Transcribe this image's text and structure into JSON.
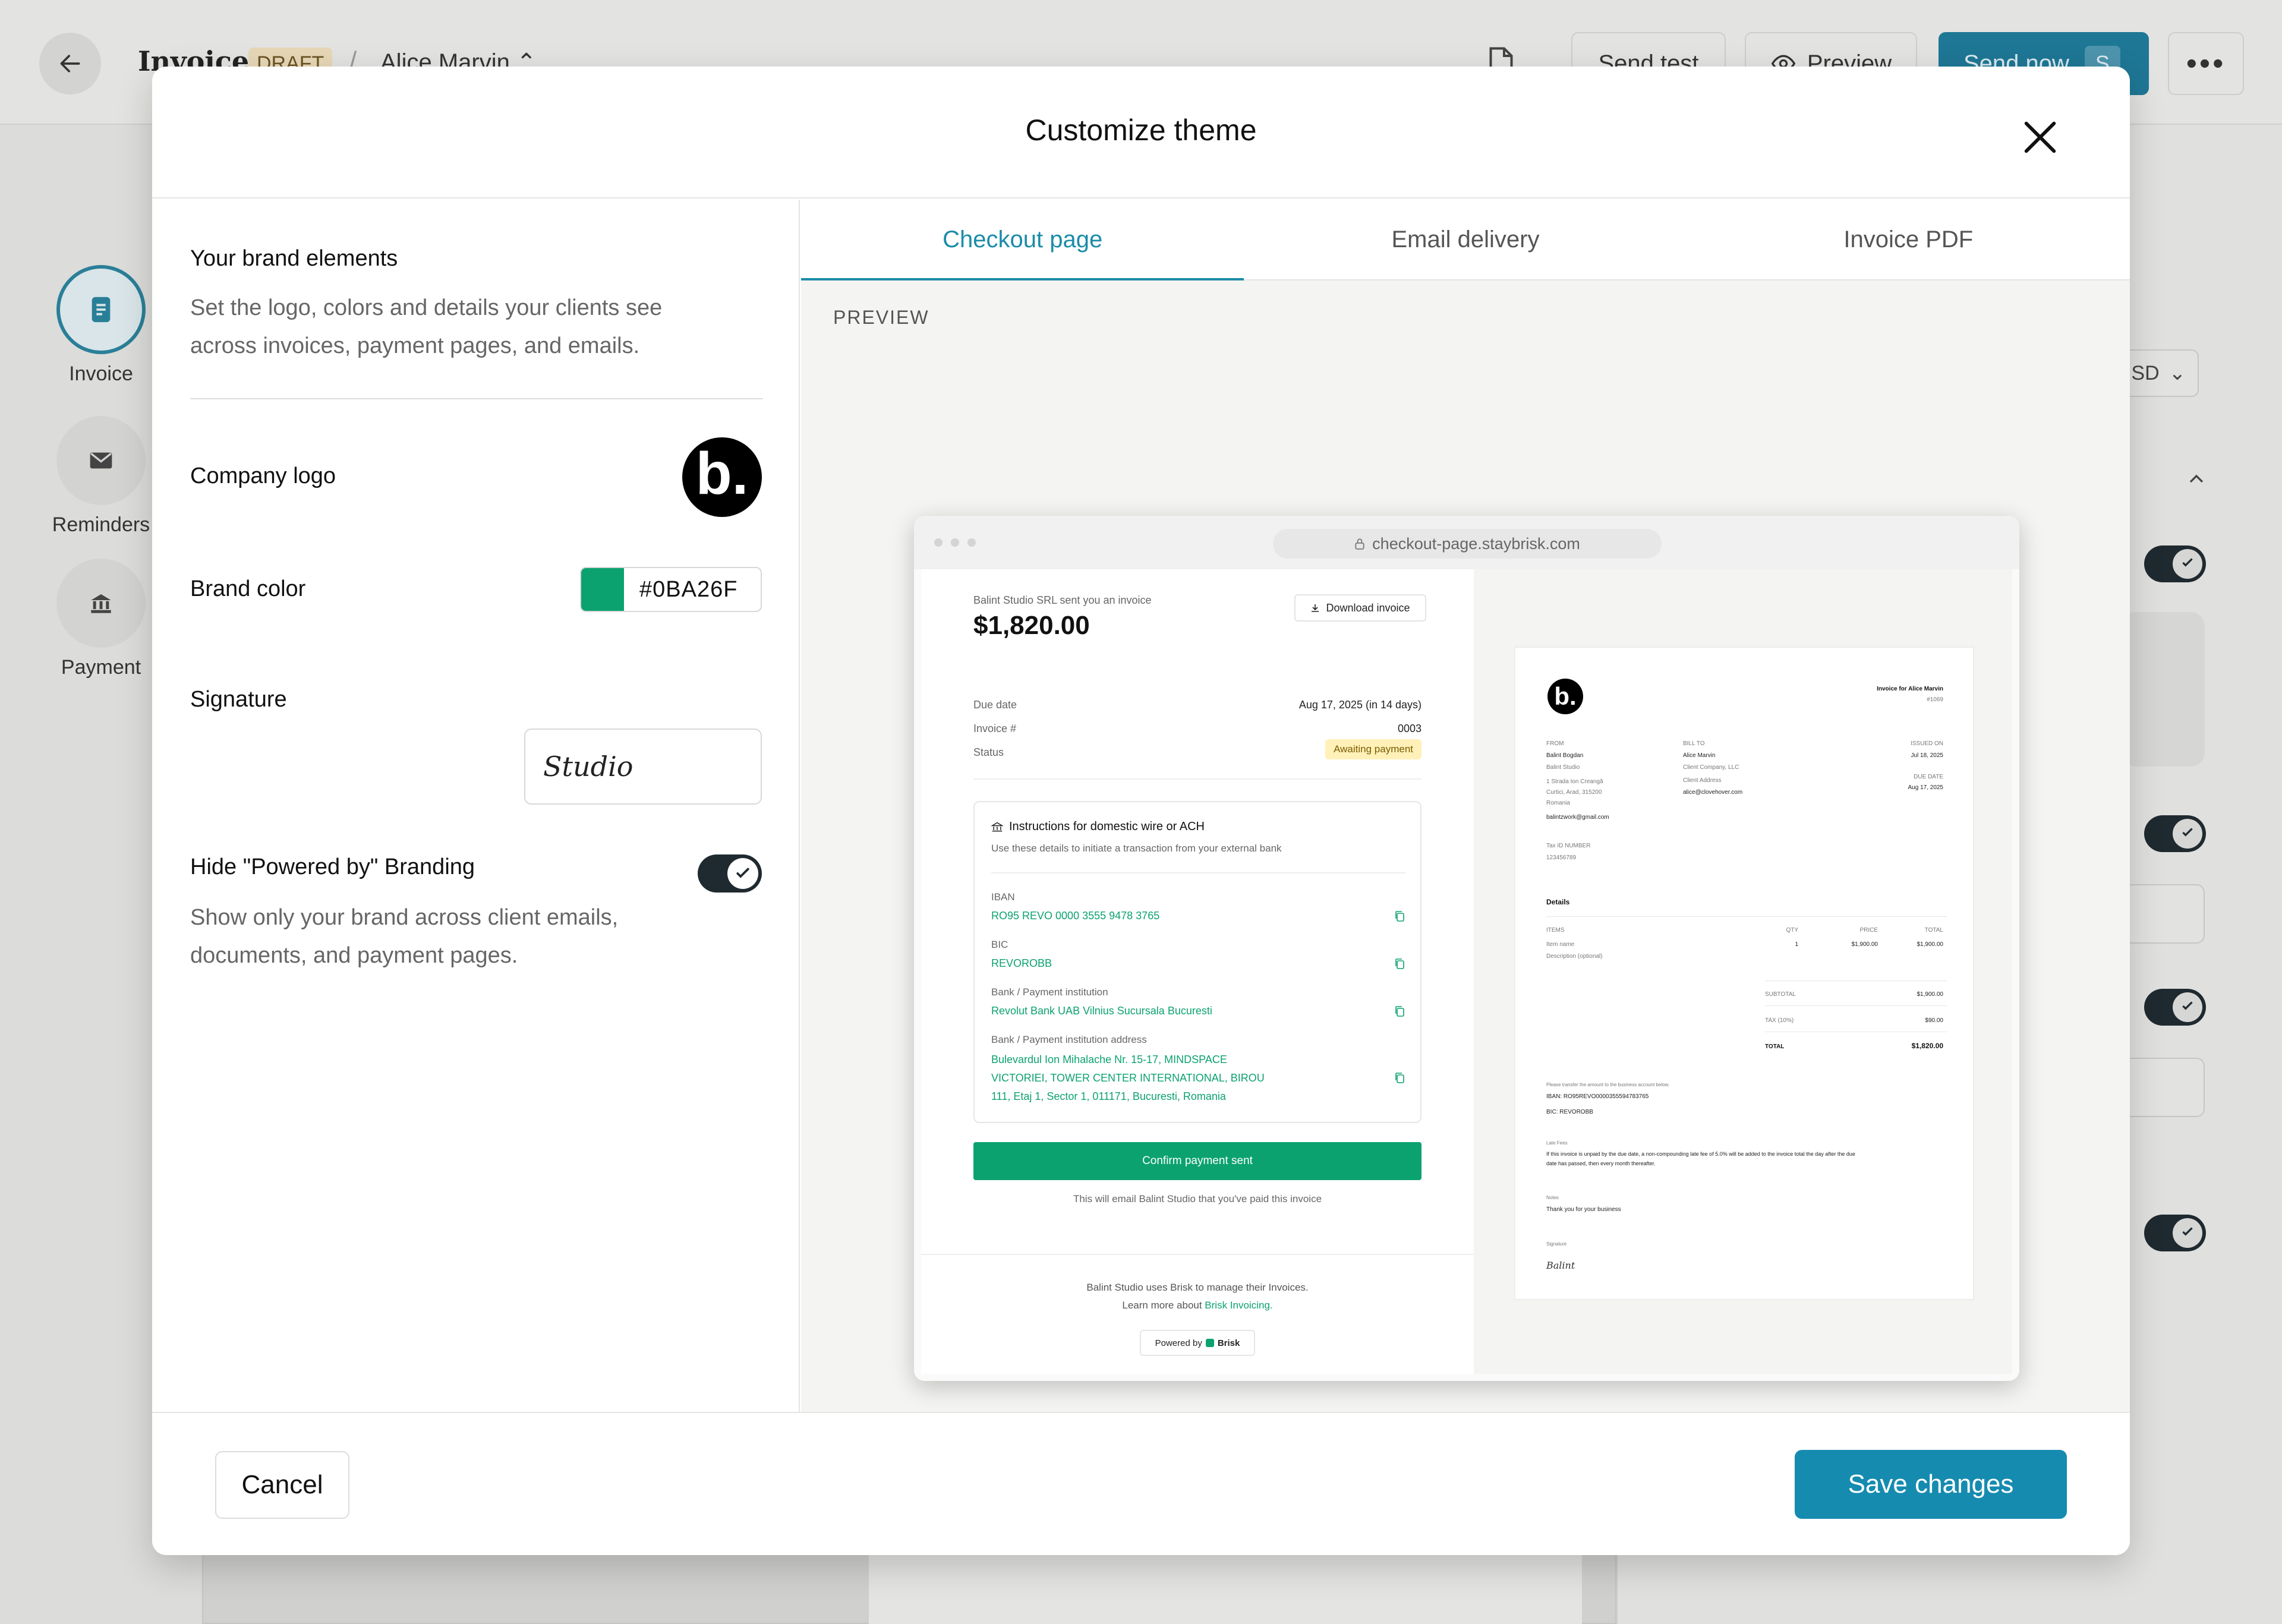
{
  "background": {
    "title": "Invoice",
    "badge": "DRAFT",
    "separator": "/",
    "client": "Alice Marvin",
    "send_test": "Send test",
    "preview": "Preview",
    "send_now": "Send now",
    "send_now_key": "S",
    "more": "•••",
    "currency": "USD",
    "rail": [
      {
        "label": "Invoice",
        "icon": "document-icon"
      },
      {
        "label": "Reminders",
        "icon": "mail-icon"
      },
      {
        "label": "Payment",
        "icon": "bank-icon"
      }
    ]
  },
  "modal": {
    "title": "Customize theme",
    "brand": {
      "title": "Your brand elements",
      "description": "Set the logo, colors and details your clients see across invoices, payment pages, and emails."
    },
    "company_logo_label": "Company logo",
    "logo_letter": "b.",
    "brand_color_label": "Brand color",
    "brand_color": "#0BA26F",
    "brand_color_text": "#0BA26F",
    "signature_label": "Signature",
    "signature_text": "Studio",
    "hide_branding_label": "Hide \"Powered by\" Branding",
    "hide_branding_on": true,
    "hide_branding_desc": "Show only your brand across client emails, documents, and payment pages.",
    "tabs": [
      "Checkout page",
      "Email delivery",
      "Invoice PDF"
    ],
    "active_tab": 0,
    "preview_label": "PREVIEW",
    "cancel": "Cancel",
    "save": "Save changes",
    "accent": "#168BB0"
  },
  "checkout": {
    "url": "checkout-page.staybrisk.com",
    "sender_line": "Balint Studio SRL sent you an invoice",
    "amount": "$1,820.00",
    "download": "Download invoice",
    "due_label": "Due date",
    "due_value": "Aug 17, 2025 (in 14 days)",
    "invoice_label": "Invoice #",
    "invoice_value": "0003",
    "status_label": "Status",
    "status_value": "Awaiting payment",
    "wire_title": "Instructions for domestic wire or ACH",
    "wire_sub": "Use these details to initiate a transaction from your external bank",
    "iban_label": "IBAN",
    "iban": "RO95 REVO 0000 3555 9478 3765",
    "bic_label": "BIC",
    "bic": "REVOROBB",
    "bank_label": "Bank / Payment institution",
    "bank": "Revolut Bank UAB Vilnius Sucursala Bucuresti",
    "address_label": "Bank / Payment institution address",
    "address": "Bulevardul Ion Mihalache Nr. 15-17, MINDSPACE VICTORIEI, TOWER CENTER INTERNATIONAL, BIROU 111, Etaj 1, Sector 1, 011171, Bucuresti, Romania",
    "confirm": "Confirm payment sent",
    "confirm_note": "This will email Balint Studio that you've paid this invoice",
    "footer_line1": "Balint Studio uses Brisk to manage their Invoices.",
    "footer_line2_prefix": "Learn more about ",
    "footer_link": "Brisk Invoicing.",
    "powered_by": "Powered by",
    "brisk": "Brisk"
  },
  "invoice_pdf": {
    "logo_letter": "b.",
    "title": "Invoice for Alice Marvin",
    "number": "#1069",
    "from_label": "FROM",
    "from_name": "Balint Bogdan",
    "from_company": "Balint Studio",
    "from_addr1": "1 Strada Ion Creangă",
    "from_addr2": "Curtici, Arad, 315200",
    "from_country": "Romania",
    "from_email": "balintzwork@gmail.com",
    "bill_label": "BILL TO",
    "bill_name": "Alice Marvin",
    "bill_company": "Client Company, LLC",
    "bill_address": "Client Address",
    "bill_email": "alice@clovehover.com",
    "issued_label": "ISSUED ON",
    "issued": "Jul 18, 2025",
    "due_label": "DUE DATE",
    "due": "Aug 17, 2025",
    "tax_label": "Tax ID NUMBER",
    "tax": "123456789",
    "details": "Details",
    "col_items": "ITEMS",
    "col_qty": "QTY",
    "col_price": "PRICE",
    "col_total": "TOTAL",
    "item_name": "Item name",
    "item_desc": "Description (optional)",
    "item_qty": "1",
    "item_price": "$1,900.00",
    "item_total": "$1,900.00",
    "subtotal_label": "SUBTOTAL",
    "subtotal": "$1,900.00",
    "tax_row_label": "TAX (10%)",
    "tax_row": "$90.00",
    "total_label": "TOTAL",
    "total": "$1,820.00",
    "transfer_note": "Please transfer the amount to the business account below.",
    "iban_line": "IBAN: RO95REVO0000355594783765",
    "bic_line": "BIC: REVOROBB",
    "late_label": "Late Fees",
    "late_text": "If this invoice is unpaid by the due date, a non-compounding late fee of 5.0% will be added to the invoice total the day after the due date has passed, then every month thereafter.",
    "notes_label": "Notes",
    "notes": "Thank you for your business",
    "signature_label": "Signature",
    "signature": "Balint"
  }
}
